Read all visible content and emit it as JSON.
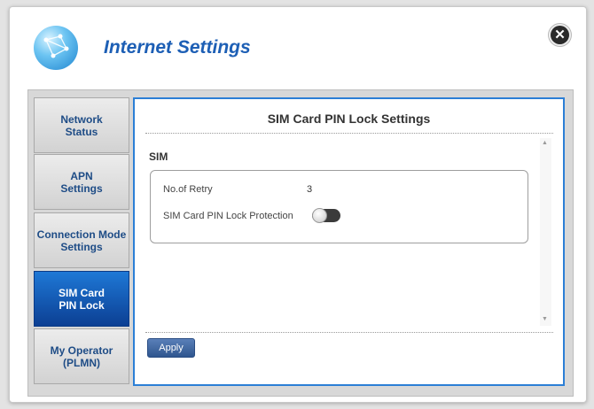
{
  "header": {
    "title": "Internet Settings",
    "close_icon": "close-icon"
  },
  "sidebar": {
    "items": [
      {
        "line1": "Network",
        "line2": "Status",
        "active": false
      },
      {
        "line1": "APN",
        "line2": "Settings",
        "active": false
      },
      {
        "line1": "Connection Mode",
        "line2": "Settings",
        "active": false
      },
      {
        "line1": "SIM Card",
        "line2": "PIN Lock",
        "active": true
      },
      {
        "line1": "My Operator",
        "line2": "(PLMN)",
        "active": false
      }
    ]
  },
  "main": {
    "title": "SIM Card PIN Lock Settings",
    "section": "SIM",
    "retry_label": "No.of Retry",
    "retry_value": "3",
    "pin_lock_label": "SIM Card PIN Lock Protection",
    "pin_lock_enabled": false,
    "apply_label": "Apply"
  },
  "colors": {
    "title": "#1d5fb5",
    "active_tab": "#0c3f93",
    "content_border": "#2c7fd6",
    "apply_button": "#3a5f97"
  }
}
